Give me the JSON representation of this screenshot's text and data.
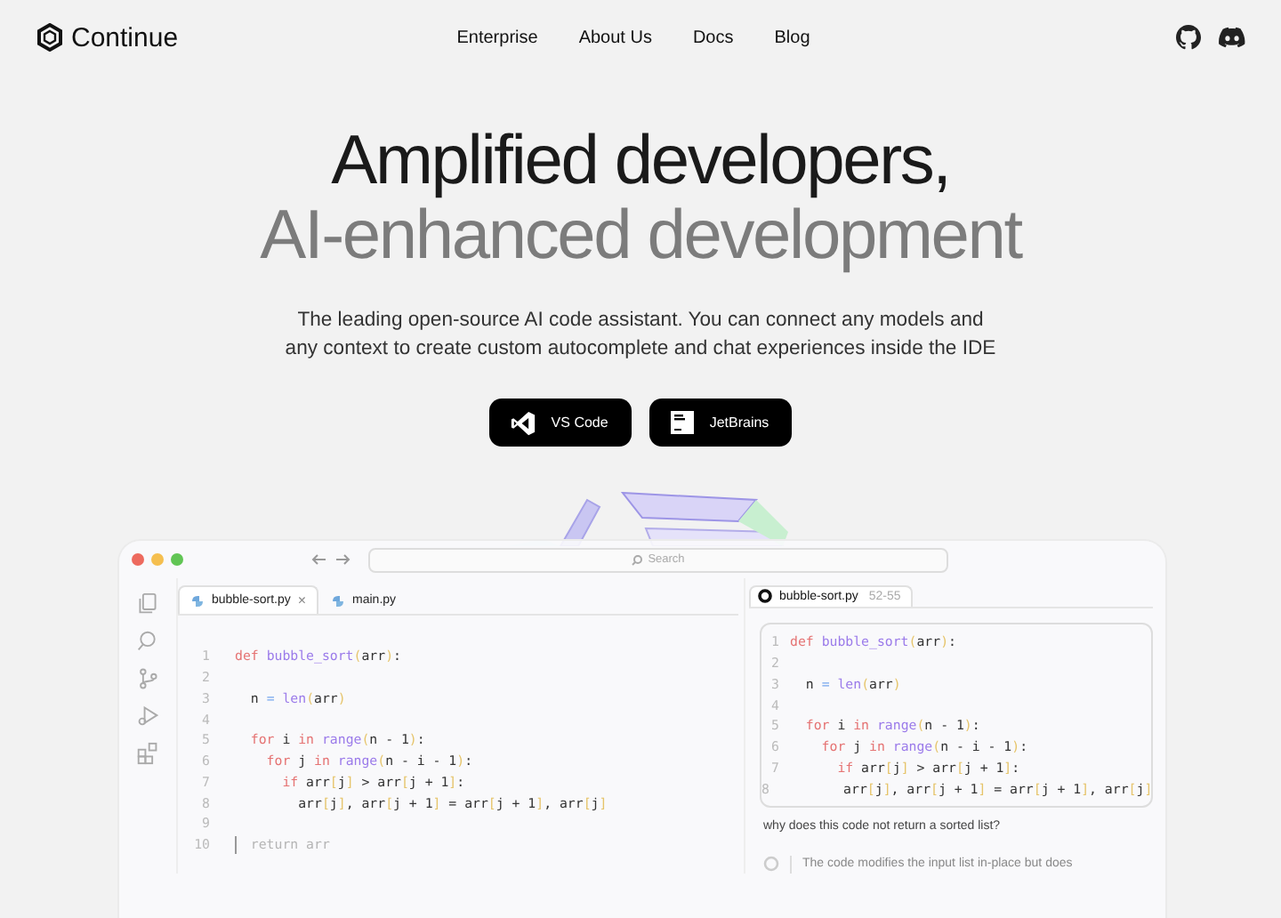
{
  "nav": {
    "brand": "Continue",
    "links": [
      "Enterprise",
      "About Us",
      "Docs",
      "Blog"
    ]
  },
  "hero": {
    "title_lines": [
      "Amplified developers,",
      "AI-enhanced development"
    ],
    "subtitle": "The leading open-source AI code assistant. You can connect any models and any context to create custom autocomplete and chat experiences inside the IDE",
    "buttons": [
      {
        "kind": "vscode",
        "label": "VS Code"
      },
      {
        "kind": "jetbrains",
        "label": "JetBrains"
      }
    ]
  },
  "editor": {
    "search_placeholder": "Search",
    "tabs": [
      {
        "label": "bubble-sort.py",
        "selected": true,
        "close": "×"
      },
      {
        "label": "main.py",
        "selected": false
      }
    ],
    "lines": [
      {
        "number": "1",
        "tokens": [
          {
            "kind": "kw",
            "text": "def "
          },
          {
            "kind": "fn",
            "text": "bubble_sort"
          },
          {
            "kind": "p",
            "text": "("
          },
          {
            "kind": "t",
            "text": "arr"
          },
          {
            "kind": "p",
            "text": ")"
          },
          {
            "kind": "t",
            "text": ":"
          }
        ]
      },
      {
        "number": "2"
      },
      {
        "number": "3",
        "tokens": [
          {
            "kind": "t",
            "text": "  n "
          },
          {
            "kind": "op",
            "text": "= "
          },
          {
            "kind": "fn",
            "text": "len"
          },
          {
            "kind": "p",
            "text": "("
          },
          {
            "kind": "t",
            "text": "arr"
          },
          {
            "kind": "p",
            "text": ")"
          }
        ]
      },
      {
        "number": "4"
      },
      {
        "number": "5",
        "tokens": [
          {
            "kind": "kw",
            "text": "  for "
          },
          {
            "kind": "t",
            "text": "i "
          },
          {
            "kind": "kw",
            "text": "in "
          },
          {
            "kind": "fn",
            "text": "range"
          },
          {
            "kind": "p",
            "text": "("
          },
          {
            "kind": "t",
            "text": "n - 1"
          },
          {
            "kind": "p",
            "text": ")"
          },
          {
            "kind": "t",
            "text": ":"
          }
        ]
      },
      {
        "number": "6",
        "tokens": [
          {
            "kind": "kw",
            "text": "    for "
          },
          {
            "kind": "t",
            "text": "j "
          },
          {
            "kind": "kw",
            "text": "in "
          },
          {
            "kind": "fn",
            "text": "range"
          },
          {
            "kind": "p",
            "text": "("
          },
          {
            "kind": "t",
            "text": "n - i - 1"
          },
          {
            "kind": "p",
            "text": ")"
          },
          {
            "kind": "t",
            "text": ":"
          }
        ]
      },
      {
        "number": "7",
        "tokens": [
          {
            "kind": "kw",
            "text": "      if "
          },
          {
            "kind": "t",
            "text": "arr"
          },
          {
            "kind": "p",
            "text": "["
          },
          {
            "kind": "t",
            "text": "j"
          },
          {
            "kind": "p",
            "text": "]"
          },
          {
            "kind": "t",
            "text": " > arr"
          },
          {
            "kind": "p",
            "text": "["
          },
          {
            "kind": "t",
            "text": "j + 1"
          },
          {
            "kind": "p",
            "text": "]"
          },
          {
            "kind": "t",
            "text": ":"
          }
        ]
      },
      {
        "number": "8",
        "tokens": [
          {
            "kind": "t",
            "text": "        arr"
          },
          {
            "kind": "p",
            "text": "["
          },
          {
            "kind": "t",
            "text": "j"
          },
          {
            "kind": "p",
            "text": "]"
          },
          {
            "kind": "t",
            "text": ", arr"
          },
          {
            "kind": "p",
            "text": "["
          },
          {
            "kind": "t",
            "text": "j + 1"
          },
          {
            "kind": "p",
            "text": "]"
          },
          {
            "kind": "t",
            "text": " = arr"
          },
          {
            "kind": "p",
            "text": "["
          },
          {
            "kind": "t",
            "text": "j + 1"
          },
          {
            "kind": "p",
            "text": "]"
          },
          {
            "kind": "t",
            "text": ", arr"
          },
          {
            "kind": "p",
            "text": "["
          },
          {
            "kind": "t",
            "text": "j"
          },
          {
            "kind": "p",
            "text": "]"
          }
        ]
      },
      {
        "number": "9"
      },
      {
        "number": "10",
        "cursor": true,
        "tokens": [
          {
            "kind": "cm",
            "text": "  return arr"
          }
        ]
      }
    ]
  },
  "chat": {
    "file": "bubble-sort.py",
    "range": "52-55",
    "lines": [
      {
        "number": "1",
        "tokens": [
          {
            "kind": "kw",
            "text": "def "
          },
          {
            "kind": "fn",
            "text": "bubble_sort"
          },
          {
            "kind": "p",
            "text": "("
          },
          {
            "kind": "t",
            "text": "arr"
          },
          {
            "kind": "p",
            "text": ")"
          },
          {
            "kind": "t",
            "text": ":"
          }
        ]
      },
      {
        "number": "2"
      },
      {
        "number": "3",
        "tokens": [
          {
            "kind": "t",
            "text": "  n "
          },
          {
            "kind": "op",
            "text": "= "
          },
          {
            "kind": "fn",
            "text": "len"
          },
          {
            "kind": "p",
            "text": "("
          },
          {
            "kind": "t",
            "text": "arr"
          },
          {
            "kind": "p",
            "text": ")"
          }
        ]
      },
      {
        "number": "4"
      },
      {
        "number": "5",
        "tokens": [
          {
            "kind": "kw",
            "text": "  for "
          },
          {
            "kind": "t",
            "text": "i "
          },
          {
            "kind": "kw",
            "text": "in "
          },
          {
            "kind": "fn",
            "text": "range"
          },
          {
            "kind": "p",
            "text": "("
          },
          {
            "kind": "t",
            "text": "n - 1"
          },
          {
            "kind": "p",
            "text": ")"
          },
          {
            "kind": "t",
            "text": ":"
          }
        ]
      },
      {
        "number": "6",
        "tokens": [
          {
            "kind": "kw",
            "text": "    for "
          },
          {
            "kind": "t",
            "text": "j "
          },
          {
            "kind": "kw",
            "text": "in "
          },
          {
            "kind": "fn",
            "text": "range"
          },
          {
            "kind": "p",
            "text": "("
          },
          {
            "kind": "t",
            "text": "n - i - 1"
          },
          {
            "kind": "p",
            "text": ")"
          },
          {
            "kind": "t",
            "text": ":"
          }
        ]
      },
      {
        "number": "7",
        "tokens": [
          {
            "kind": "kw",
            "text": "      if "
          },
          {
            "kind": "t",
            "text": "arr"
          },
          {
            "kind": "p",
            "text": "["
          },
          {
            "kind": "t",
            "text": "j"
          },
          {
            "kind": "p",
            "text": "]"
          },
          {
            "kind": "t",
            "text": " > arr"
          },
          {
            "kind": "p",
            "text": "["
          },
          {
            "kind": "t",
            "text": "j + 1"
          },
          {
            "kind": "p",
            "text": "]"
          },
          {
            "kind": "t",
            "text": ":"
          }
        ]
      },
      {
        "number": "8",
        "tokens": [
          {
            "kind": "t",
            "text": "        arr"
          },
          {
            "kind": "p",
            "text": "["
          },
          {
            "kind": "t",
            "text": "j"
          },
          {
            "kind": "p",
            "text": "]"
          },
          {
            "kind": "t",
            "text": ", arr"
          },
          {
            "kind": "p",
            "text": "["
          },
          {
            "kind": "t",
            "text": "j + 1"
          },
          {
            "kind": "p",
            "text": "]"
          },
          {
            "kind": "t",
            "text": " = arr"
          },
          {
            "kind": "p",
            "text": "["
          },
          {
            "kind": "t",
            "text": "j + 1"
          },
          {
            "kind": "p",
            "text": "]"
          },
          {
            "kind": "t",
            "text": ", arr"
          },
          {
            "kind": "p",
            "text": "["
          },
          {
            "kind": "t",
            "text": "j"
          },
          {
            "kind": "p",
            "text": "]"
          }
        ]
      }
    ],
    "question": "why does this code not return a sorted list?",
    "answer": "The code modifies the input list in-place but does"
  }
}
